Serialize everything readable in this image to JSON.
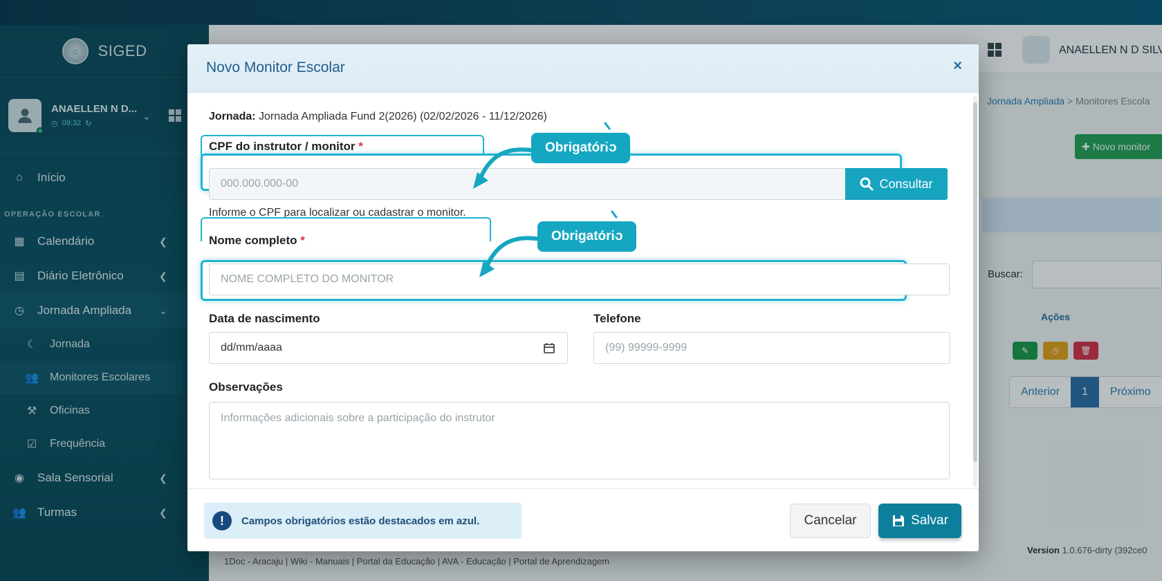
{
  "app": {
    "brand": "SIGED",
    "user_short": "ANAELLEN N D...",
    "session_time": "09:32",
    "header_user": "ANAELLEN N D SILVA"
  },
  "sidebar": {
    "home": "Início",
    "section": "OPERAÇÃO ESCOLAR",
    "items": [
      {
        "label": "Calendário"
      },
      {
        "label": "Diário Eletrônico"
      },
      {
        "label": "Jornada Ampliada"
      }
    ],
    "sub_items": [
      {
        "label": "Jornada"
      },
      {
        "label": "Monitores Escolares"
      },
      {
        "label": "Oficinas"
      },
      {
        "label": "Frequência"
      }
    ],
    "items_after": [
      {
        "label": "Sala Sensorial"
      },
      {
        "label": "Turmas"
      }
    ]
  },
  "background": {
    "breadcrumb_link": "Jornada Ampliada",
    "breadcrumb_current": "Monitores Escola",
    "new_button": "Novo monitor",
    "search_label": "Buscar:",
    "actions_header": "Ações",
    "pager": {
      "prev": "Anterior",
      "page": "1",
      "next": "Próximo"
    },
    "footer_links": "1Doc - Aracaju | Wiki - Manuais | Portal da Educação | AVA - Educação | Portal de Aprendizagem",
    "version_label": "Version",
    "version_value": "1.0.676-dirty (392ce0"
  },
  "modal": {
    "title": "Novo Monitor Escolar",
    "close": "×",
    "jornada_label": "Jornada:",
    "jornada_value": "Jornada Ampliada Fund 2(2026) (02/02/2026 - 11/12/2026)",
    "cpf_label": "CPF do instrutor / monitor",
    "required_mark": "*",
    "cpf_placeholder": "000.000.000-00",
    "consult_button": "Consultar",
    "cpf_help": "Informe o CPF para localizar ou cadastrar o monitor.",
    "nome_label": "Nome completo",
    "nome_placeholder": "NOME COMPLETO DO MONITOR",
    "nascimento_label": "Data de nascimento",
    "nascimento_placeholder": "dd/mm/aaaa",
    "telefone_label": "Telefone",
    "telefone_placeholder": "(99) 99999-9999",
    "obs_label": "Observações",
    "obs_placeholder": "Informações adicionais sobre a participação do instrutor",
    "required_badge": "Obrigatório",
    "alert_text": "Campos obrigatórios estão destacados em azul.",
    "cancel_button": "Cancelar",
    "save_button": "Salvar"
  },
  "colors": {
    "accent": "#15a7c2",
    "primary": "#0c7f9c",
    "sidebar_bg": "#0f4a5c",
    "required": "#d9334a"
  }
}
